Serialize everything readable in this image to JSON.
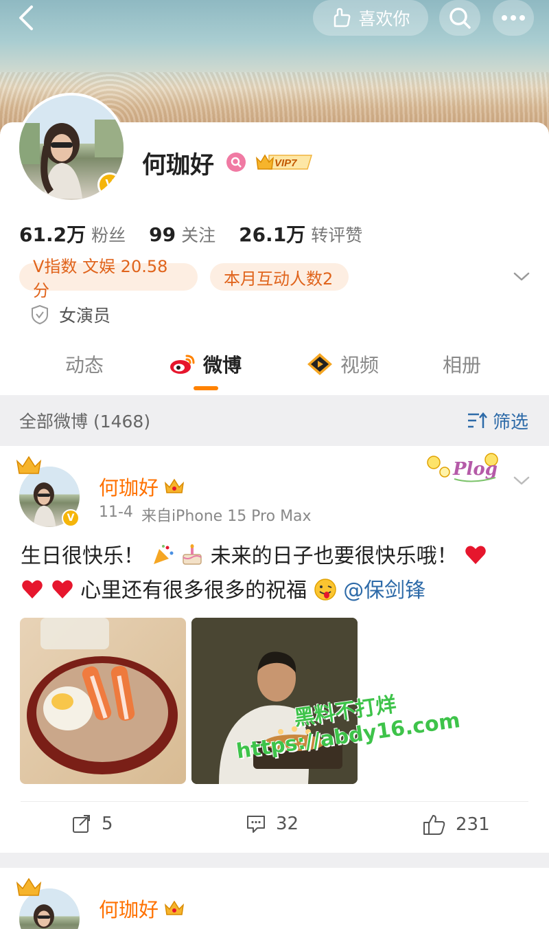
{
  "header": {
    "like_label": "喜欢你",
    "icons": [
      "back-icon",
      "like-hand-icon",
      "search-icon",
      "more-icon"
    ]
  },
  "profile": {
    "name": "何珈好",
    "vip_label": "VIP7",
    "verified_mark": "V",
    "stats": [
      {
        "value": "61.2万",
        "label": "粉丝"
      },
      {
        "value": "99",
        "label": "关注"
      },
      {
        "value": "26.1万",
        "label": "转评赞"
      }
    ],
    "pill_vindex": "V指数 文娱 20.58分",
    "pill_monthly": "本月互动人数2",
    "tag": "女演员"
  },
  "tabs": [
    {
      "label": "动态",
      "active": false
    },
    {
      "label": "微博",
      "active": true
    },
    {
      "label": "视频",
      "active": false
    },
    {
      "label": "相册",
      "active": false
    }
  ],
  "filter": {
    "title": "全部微博 (1468)",
    "button": "筛选"
  },
  "post": {
    "author": "何珈好",
    "date": "11-4",
    "source": "来自iPhone 15 Pro Max",
    "sticker_text": "Plog",
    "text_part1": "生日很快乐！",
    "text_part2": "未来的日子也要很快乐哦！",
    "text_part3": "心里还有很多很多的祝福",
    "mention": "@保剑锋",
    "reposts": "5",
    "comments": "32",
    "likes": "231"
  },
  "watermark": {
    "line1": "黑料不打烊",
    "line2": "https://abdy16.com"
  },
  "post2": {
    "author": "何珈好"
  },
  "colors": {
    "accent_orange": "#ff8200",
    "name_orange": "#ff7100",
    "link_blue": "#2d6aa8",
    "verified_gold": "#f5b50a"
  }
}
